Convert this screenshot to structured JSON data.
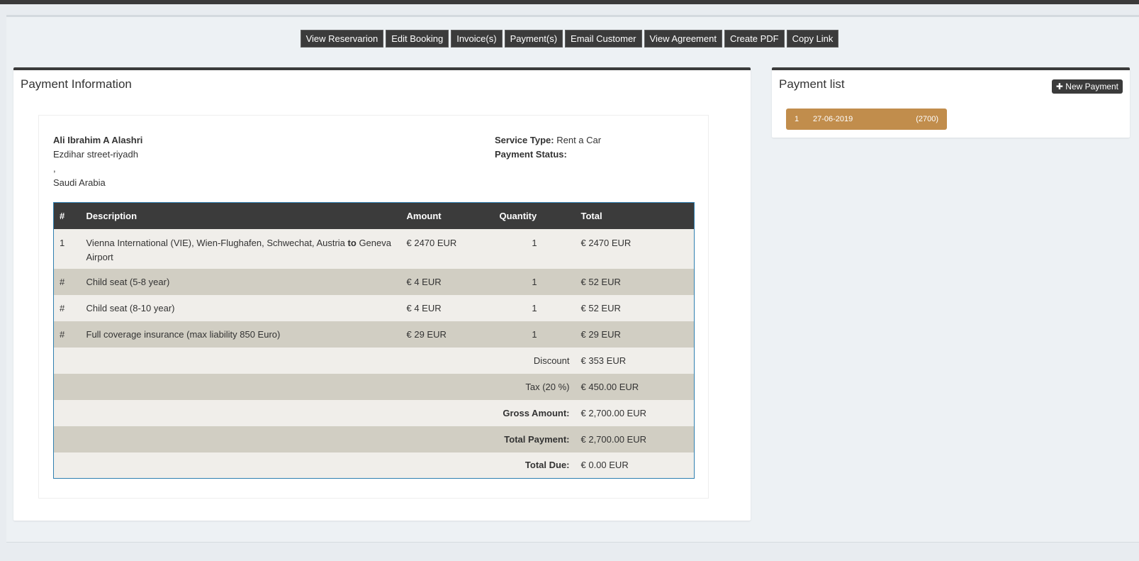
{
  "toolbar": {
    "buttons": [
      "View Reservarion",
      "Edit Booking",
      "Invoice(s)",
      "Payment(s)",
      "Email Customer",
      "View Agreement",
      "Create PDF",
      "Copy Link"
    ]
  },
  "payment_info": {
    "title": "Payment Information",
    "customer": {
      "name": "Ali Ibrahim A Alashri",
      "address1": "Ezdihar street-riyadh",
      "address2": ",",
      "country": "Saudi Arabia"
    },
    "service_type_label": "Service Type:",
    "service_type_value": "Rent a Car",
    "payment_status_label": "Payment Status:",
    "table": {
      "headers": [
        "#",
        "Description",
        "Amount",
        "Quantity",
        "Total"
      ],
      "first_row": {
        "num": "1",
        "desc_from": "Vienna International (VIE), Wien-Flughafen, Schwechat, Austria",
        "desc_to_word": "to",
        "desc_to": "Geneva Airport",
        "amount": "€ 2470 EUR",
        "qty": "1",
        "total": "€ 2470 EUR"
      },
      "rows": [
        {
          "num": "#",
          "desc": "Child seat (5-8 year)",
          "amount": "€ 4 EUR",
          "qty": "1",
          "total": "€ 52 EUR"
        },
        {
          "num": "#",
          "desc": "Child seat (8-10 year)",
          "amount": "€ 4 EUR",
          "qty": "1",
          "total": "€ 52 EUR"
        },
        {
          "num": "#",
          "desc": "Full coverage insurance (max liability 850 Euro)",
          "amount": "€ 29 EUR",
          "qty": "1",
          "total": "€ 29 EUR"
        }
      ],
      "summary": [
        {
          "label": "Discount",
          "value": "€ 353 EUR"
        },
        {
          "label": "Tax (20 %)",
          "value": "€ 450.00 EUR"
        },
        {
          "label": "Gross Amount:",
          "value": "€ 2,700.00 EUR"
        },
        {
          "label": "Total Payment:",
          "value": "€ 2,700.00 EUR"
        },
        {
          "label": "Total Due:",
          "value": "€ 0.00 EUR"
        }
      ]
    }
  },
  "payment_list": {
    "title": "Payment list",
    "new_button": "New Payment",
    "new_icon": "plus-icon",
    "items": [
      {
        "num": "1",
        "date": "27-06-2019",
        "amount": "(2700)"
      }
    ]
  },
  "colors": {
    "dark": "#3b3b3b",
    "row_light": "#f0eeea",
    "row_dark": "#d1cec3",
    "payment_item": "#c18d4c"
  }
}
